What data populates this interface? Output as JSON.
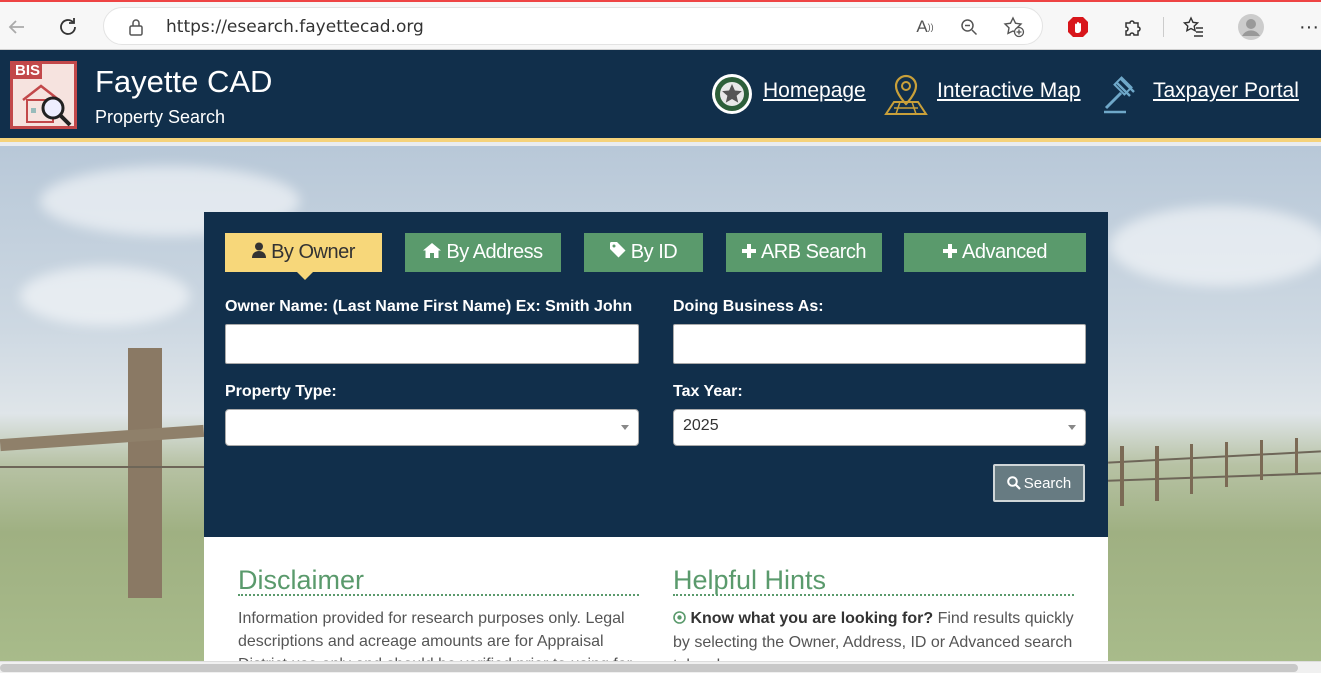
{
  "browser": {
    "url": "https://esearch.fayettecad.org",
    "back_icon": "back-arrow-icon",
    "refresh_icon": "refresh-icon"
  },
  "header": {
    "logo_text": "BIS",
    "title": "Fayette CAD",
    "subtitle": "Property Search",
    "links": [
      {
        "label": "Homepage",
        "icon": "texas-star-seal-icon"
      },
      {
        "label": "Interactive Map",
        "icon": "map-pin-icon"
      },
      {
        "label": "Taxpayer Portal",
        "icon": "gavel-icon"
      }
    ]
  },
  "tabs": [
    {
      "label": "By Owner",
      "icon": "user-icon",
      "active": true
    },
    {
      "label": "By Address",
      "icon": "home-icon",
      "active": false
    },
    {
      "label": "By ID",
      "icon": "tag-icon",
      "active": false
    },
    {
      "label": "ARB Search",
      "icon": "plus-icon",
      "active": false
    },
    {
      "label": "Advanced",
      "icon": "plus-icon",
      "active": false
    }
  ],
  "form": {
    "owner_label": "Owner Name: (Last Name First Name) Ex: Smith John",
    "owner_value": "",
    "dba_label": "Doing Business As:",
    "dba_value": "",
    "property_type_label": "Property Type:",
    "property_type_value": "",
    "tax_year_label": "Tax Year:",
    "tax_year_value": "2025",
    "search_label": "Search"
  },
  "info": {
    "disclaimer_title": "Disclaimer",
    "disclaimer_text": "Information provided for research purposes only. Legal descriptions and acreage amounts are for Appraisal District use only and should be verified prior to using for",
    "hints_title": "Helpful Hints",
    "hints_bold": "Know what you are looking for?",
    "hints_text": " Find results quickly by selecting the Owner, Address, ID or Advanced search tabs above."
  },
  "colors": {
    "navy": "#112f4b",
    "green": "#5a9a6c",
    "active_tab": "#f7d77a",
    "accent_line": "#f5d27a"
  }
}
